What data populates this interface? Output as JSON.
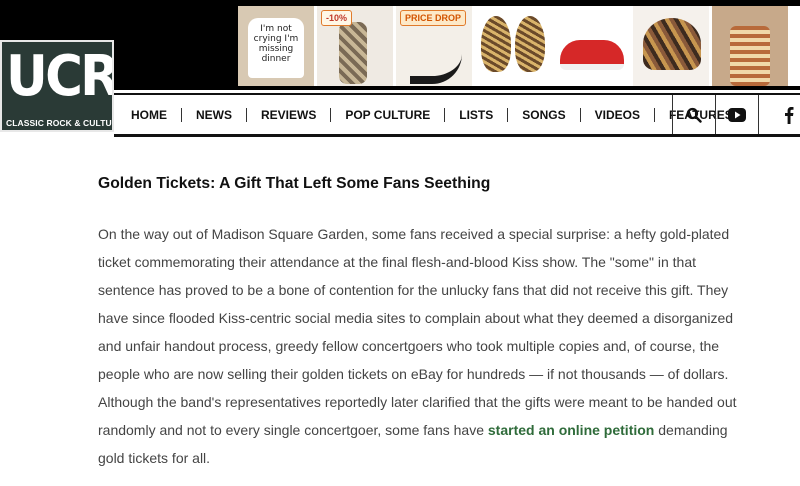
{
  "logo": {
    "letters": "UCR",
    "tagline": "CLASSIC ROCK & CULTURE"
  },
  "ads": [
    {
      "name": "onesie",
      "text": "I'm not crying I'm missing dinner"
    },
    {
      "name": "leggings",
      "badge": "-10%"
    },
    {
      "name": "heels",
      "badge": "PRICE DROP"
    },
    {
      "name": "bulbs"
    },
    {
      "name": "red-shoes"
    },
    {
      "name": "beanie"
    },
    {
      "name": "dress"
    }
  ],
  "nav": {
    "items": [
      "HOME",
      "NEWS",
      "REVIEWS",
      "POP CULTURE",
      "LISTS",
      "SONGS",
      "VIDEOS",
      "FEATURES"
    ],
    "icons": [
      "search-icon",
      "youtube-icon",
      "facebook-icon"
    ]
  },
  "article": {
    "headline": "Golden Tickets: A Gift That Left Some Fans Seething",
    "paragraph_before_link": "On the way out of Madison Square Garden, some fans received a special surprise: a hefty gold-plated ticket commemorating their attendance at the final flesh-and-blood Kiss show. The \"some\" in that sentence has proved to be a bone of contention for the unlucky fans that did not receive this gift. They have since flooded Kiss-centric social media sites to complain about what they deemed a disorganized and unfair handout process, greedy fellow concertgoers who took multiple copies and, of course, the people who are now selling their golden tickets on eBay for hundreds — if not thousands — of dollars. Although the band's representatives reportedly later clarified that the gifts were meant to be handed out randomly and not to every single concertgoer, some fans have ",
    "link_text": "started an online petition",
    "paragraph_after_link": " demanding gold tickets for all."
  },
  "colors": {
    "link": "#2f6b3a",
    "logo_bg": "#2a3a36",
    "text": "#444444"
  }
}
